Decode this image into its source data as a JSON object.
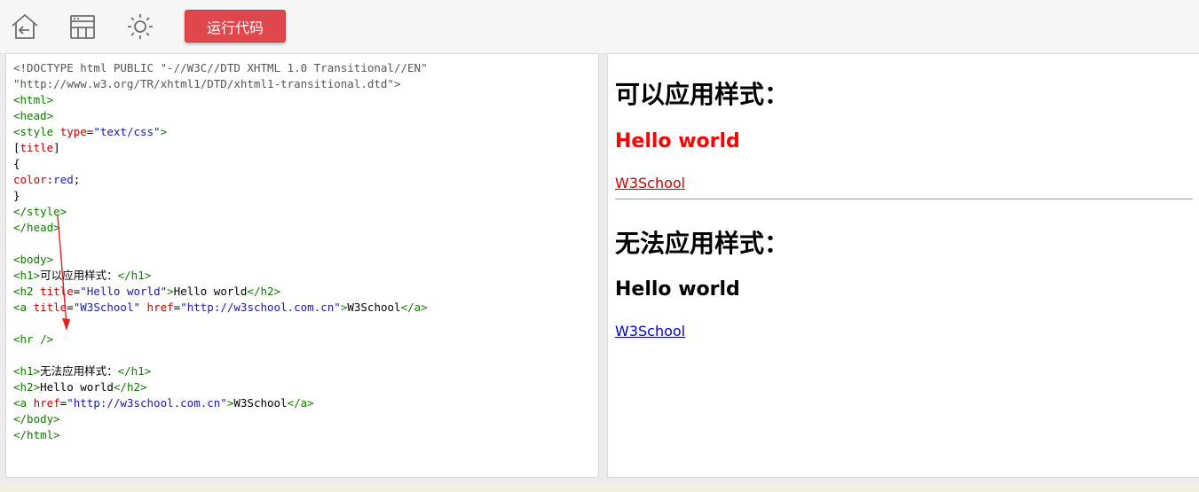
{
  "toolbar": {
    "icons": [
      "back-icon",
      "layout-icon",
      "theme-sun-icon"
    ],
    "run_label": "运行代码",
    "run_color": "#e0474c"
  },
  "editor": {
    "lines": [
      [
        {
          "c": "doc",
          "t": "<!DOCTYPE html PUBLIC \"-//W3C//DTD XHTML 1.0 Transitional//EN\""
        }
      ],
      [
        {
          "c": "doc",
          "t": "\"http://www.w3.org/TR/xhtml1/DTD/xhtml1-transitional.dtd\">"
        }
      ],
      [
        {
          "c": "tag",
          "t": "<html>"
        }
      ],
      [
        {
          "c": "tag",
          "t": "<head>"
        }
      ],
      [
        {
          "c": "tag",
          "t": "<style "
        },
        {
          "c": "attr",
          "t": "type"
        },
        {
          "c": "txt",
          "t": "="
        },
        {
          "c": "str",
          "t": "\"text/css\""
        },
        {
          "c": "tag",
          "t": ">"
        }
      ],
      [
        {
          "c": "txt",
          "t": "["
        },
        {
          "c": "attr",
          "t": "title"
        },
        {
          "c": "txt",
          "t": "]"
        }
      ],
      [
        {
          "c": "txt",
          "t": "{"
        }
      ],
      [
        {
          "c": "attr",
          "t": "color"
        },
        {
          "c": "txt",
          "t": ":"
        },
        {
          "c": "str",
          "t": "red"
        },
        {
          "c": "txt",
          "t": ";"
        }
      ],
      [
        {
          "c": "txt",
          "t": "}"
        }
      ],
      [
        {
          "c": "tag",
          "t": "</style>"
        }
      ],
      [
        {
          "c": "tag",
          "t": "</head>"
        }
      ],
      [
        {
          "c": "txt",
          "t": ""
        }
      ],
      [
        {
          "c": "tag",
          "t": "<body>"
        }
      ],
      [
        {
          "c": "tag",
          "t": "<h1>"
        },
        {
          "c": "txt",
          "t": "可以应用样式："
        },
        {
          "c": "tag",
          "t": "</h1>"
        }
      ],
      [
        {
          "c": "tag",
          "t": "<h2 "
        },
        {
          "c": "attr",
          "t": "title"
        },
        {
          "c": "txt",
          "t": "="
        },
        {
          "c": "str",
          "t": "\"Hello world\""
        },
        {
          "c": "tag",
          "t": ">"
        },
        {
          "c": "txt",
          "t": "Hello world"
        },
        {
          "c": "tag",
          "t": "</h2>"
        }
      ],
      [
        {
          "c": "tag",
          "t": "<a "
        },
        {
          "c": "attr",
          "t": "title"
        },
        {
          "c": "txt",
          "t": "="
        },
        {
          "c": "str",
          "t": "\"W3School\""
        },
        {
          "c": "txt",
          "t": " "
        },
        {
          "c": "attr",
          "t": "href"
        },
        {
          "c": "txt",
          "t": "="
        },
        {
          "c": "str",
          "t": "\"http://w3school.com.cn\""
        },
        {
          "c": "tag",
          "t": ">"
        },
        {
          "c": "txt",
          "t": "W3School"
        },
        {
          "c": "tag",
          "t": "</a>"
        }
      ],
      [
        {
          "c": "txt",
          "t": ""
        }
      ],
      [
        {
          "c": "tag",
          "t": "<hr />"
        }
      ],
      [
        {
          "c": "txt",
          "t": ""
        }
      ],
      [
        {
          "c": "tag",
          "t": "<h1>"
        },
        {
          "c": "txt",
          "t": "无法应用样式："
        },
        {
          "c": "tag",
          "t": "</h1>"
        }
      ],
      [
        {
          "c": "tag",
          "t": "<h2>"
        },
        {
          "c": "txt",
          "t": "Hello world"
        },
        {
          "c": "tag",
          "t": "</h2>"
        }
      ],
      [
        {
          "c": "tag",
          "t": "<a "
        },
        {
          "c": "attr",
          "t": "href"
        },
        {
          "c": "txt",
          "t": "="
        },
        {
          "c": "str",
          "t": "\"http://w3school.com.cn\""
        },
        {
          "c": "tag",
          "t": ">"
        },
        {
          "c": "txt",
          "t": "W3School"
        },
        {
          "c": "tag",
          "t": "</a>"
        }
      ],
      [
        {
          "c": "tag",
          "t": "</body>"
        }
      ],
      [
        {
          "c": "tag",
          "t": "</html>"
        }
      ]
    ],
    "colors": {
      "tag": "#117700",
      "attr": "#c00000",
      "str": "#1a1aa6",
      "doc": "#555555",
      "txt": "#000000"
    }
  },
  "preview": {
    "h1_a": "可以应用样式：",
    "h2_a": "Hello world",
    "h2_a_color": "#ff0000",
    "link_a": "W3School",
    "link_a_color": "#cc0000",
    "h1_b": "无法应用样式：",
    "h2_b": "Hello world",
    "link_b": "W3School",
    "link_b_color": "#0000cc"
  }
}
